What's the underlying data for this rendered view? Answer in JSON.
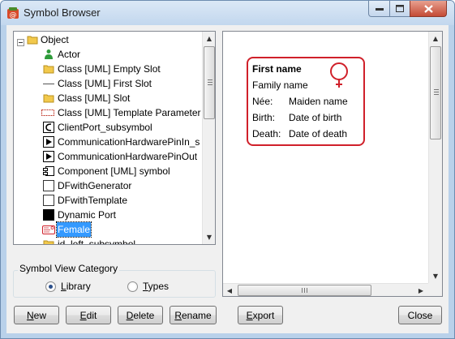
{
  "window": {
    "title": "Symbol Browser",
    "controls": {
      "minimize": "minimize",
      "maximize": "maximize",
      "close": "close"
    }
  },
  "tree": {
    "root": {
      "label": "Object",
      "icon": "folder-icon"
    },
    "items": [
      {
        "label": "Actor",
        "icon": "actor-icon"
      },
      {
        "label": "Class [UML] Empty Slot",
        "icon": "folder-icon"
      },
      {
        "label": "Class [UML] First Slot",
        "icon": "line-icon"
      },
      {
        "label": "Class [UML] Slot",
        "icon": "folder-icon"
      },
      {
        "label": "Class [UML] Template Parameter",
        "icon": "dashed-rect-icon"
      },
      {
        "label": "ClientPort_subsymbol",
        "icon": "port-c-icon"
      },
      {
        "label": "CommunicationHardwarePinIn_s",
        "icon": "triangle-right-icon"
      },
      {
        "label": "CommunicationHardwarePinOut",
        "icon": "triangle-right-icon"
      },
      {
        "label": "Component [UML] symbol",
        "icon": "component-icon"
      },
      {
        "label": "DFwithGenerator",
        "icon": "empty-box-icon"
      },
      {
        "label": "DFwithTemplate",
        "icon": "empty-box-icon"
      },
      {
        "label": "Dynamic Port",
        "icon": "black-square-icon"
      },
      {
        "label": "Female",
        "icon": "female-card-icon",
        "selected": true
      },
      {
        "label": "id_left_subsymbol",
        "icon": "folder-icon"
      }
    ]
  },
  "category": {
    "legend": "Symbol View Category",
    "options": [
      {
        "label": "Library",
        "hotkey": "L",
        "rest": "ibrary",
        "checked": true
      },
      {
        "label": "Types",
        "hotkey": "T",
        "rest": "ypes",
        "checked": false
      }
    ]
  },
  "preview": {
    "card": {
      "first_name": "First name",
      "family_name": "Family name",
      "rows": [
        {
          "label": "Née:",
          "value": "Maiden name"
        },
        {
          "label": "Birth:",
          "value": "Date of birth"
        },
        {
          "label": "Death:",
          "value": "Date of death"
        }
      ],
      "symbol": "female-symbol-icon",
      "color": "#d0202a"
    }
  },
  "buttons": {
    "new": {
      "hotkey": "N",
      "rest": "ew"
    },
    "edit": {
      "hotkey": "E",
      "rest": "dit"
    },
    "delete": {
      "hotkey": "D",
      "rest": "elete"
    },
    "rename": {
      "hotkey": "R",
      "rest": "ename"
    },
    "export": {
      "hotkey": "E",
      "rest": "xport"
    },
    "close": {
      "label": "Close"
    }
  },
  "colors": {
    "selection": "#3399ff",
    "accent_red": "#d0202a",
    "folder": "#f2c94c"
  }
}
